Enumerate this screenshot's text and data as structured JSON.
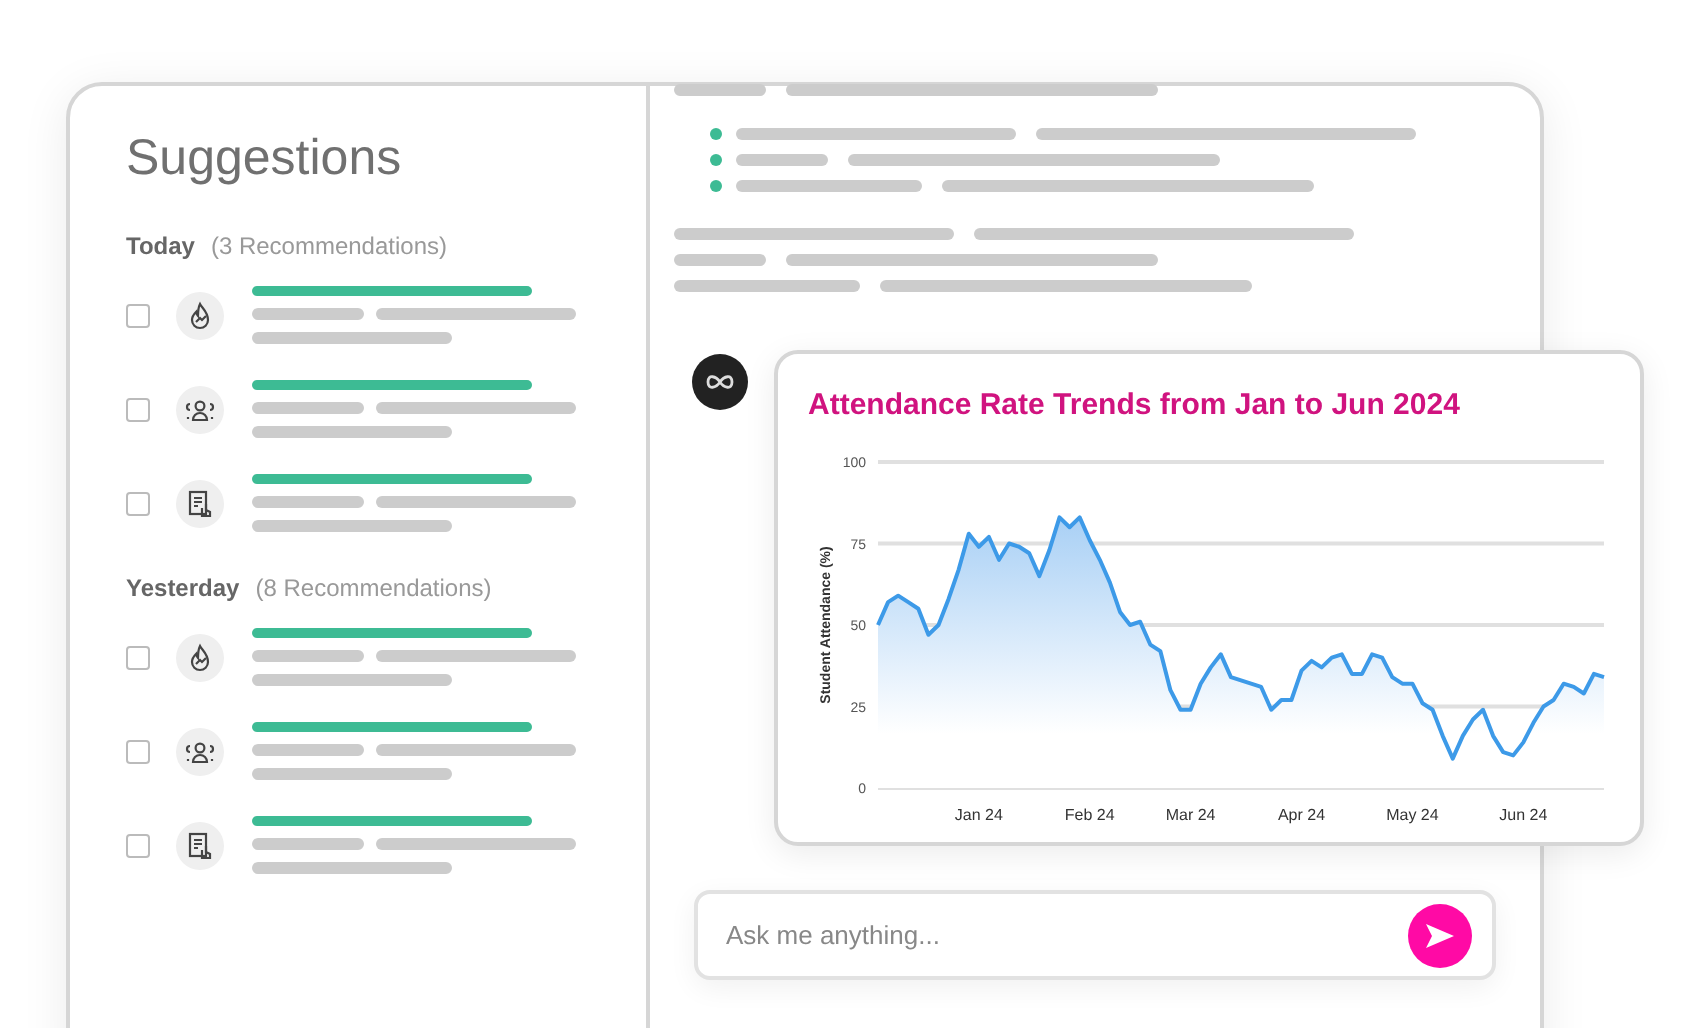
{
  "panel": {
    "title": "Suggestions"
  },
  "groups": [
    {
      "label": "Today",
      "count": "(3 Recommendations)",
      "items": [
        {
          "checked": false
        },
        {
          "checked": false
        },
        {
          "checked": false
        }
      ]
    },
    {
      "label": "Yesterday",
      "count": "(8 Recommendations)",
      "items": [
        {
          "checked": false
        },
        {
          "checked": false
        },
        {
          "checked": false
        }
      ]
    }
  ],
  "chart_card": {
    "chart_data": {
      "type": "area",
      "title": "Attendance Rate Trends from Jan to Jun 2024",
      "ylabel": "Student Attendance (%)",
      "categories": [
        null,
        null,
        null,
        null,
        null,
        null,
        null,
        null,
        null,
        null,
        "Jan 24",
        null,
        null,
        null,
        null,
        null,
        null,
        null,
        null,
        null,
        null,
        "Feb 24",
        null,
        null,
        null,
        null,
        null,
        null,
        null,
        null,
        null,
        "Mar 24",
        null,
        null,
        null,
        null,
        null,
        null,
        null,
        null,
        null,
        null,
        "Apr 24",
        null,
        null,
        null,
        null,
        null,
        null,
        null,
        null,
        null,
        null,
        "May 24",
        null,
        null,
        null,
        null,
        null,
        null,
        null,
        null,
        null,
        null,
        "Jun 24",
        null,
        null,
        null,
        null,
        null,
        null,
        null,
        null
      ],
      "series": [
        {
          "color": "#3d9ae8",
          "values": [
            50,
            57,
            59,
            57,
            55,
            47,
            50,
            58,
            67,
            78,
            74,
            77,
            70,
            75,
            74,
            72,
            65,
            73,
            83,
            80,
            83,
            76,
            70,
            63,
            54,
            50,
            51,
            44,
            42,
            30,
            24,
            24,
            32,
            37,
            41,
            34,
            33,
            32,
            31,
            24,
            27,
            27,
            36,
            39,
            37,
            40,
            41,
            35,
            35,
            41,
            40,
            34,
            32,
            32,
            26,
            24,
            16,
            9,
            16,
            21,
            24,
            16,
            11,
            10,
            14,
            20,
            25,
            27,
            32,
            31,
            29,
            35,
            34
          ]
        }
      ],
      "ylim": [
        0,
        100
      ],
      "grid": true,
      "yticks": [
        0,
        25,
        50,
        75,
        100
      ]
    }
  },
  "input": {
    "placeholder": "Ask me anything..."
  }
}
